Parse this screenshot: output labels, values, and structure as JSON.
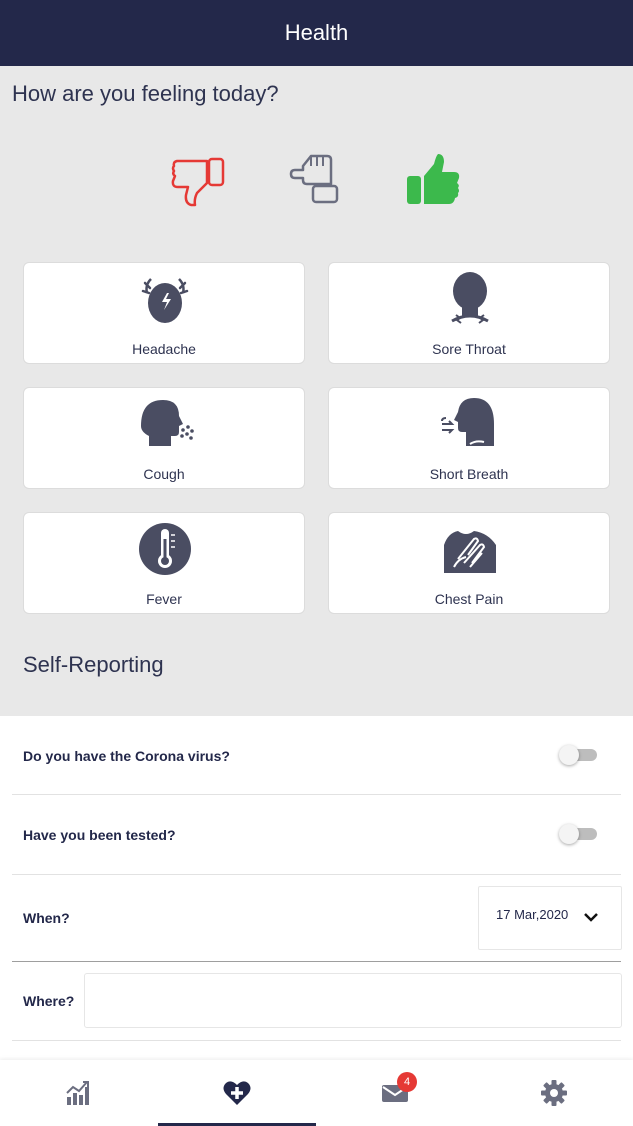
{
  "header": {
    "title": "Health"
  },
  "feeling": {
    "question": "How are you feeling today?",
    "options": [
      {
        "icon": "thumbs-down-icon",
        "color": "#e53935"
      },
      {
        "icon": "thumbs-sideways-icon",
        "color": "#6b6e80"
      },
      {
        "icon": "thumbs-up-icon",
        "color": "#3cb94c"
      }
    ]
  },
  "symptoms": [
    {
      "label": "Headache",
      "icon": "headache-icon"
    },
    {
      "label": "Sore Throat",
      "icon": "sore-throat-icon"
    },
    {
      "label": "Cough",
      "icon": "cough-icon"
    },
    {
      "label": "Short Breath",
      "icon": "short-breath-icon"
    },
    {
      "label": "Fever",
      "icon": "fever-thermometer-icon"
    },
    {
      "label": "Chest Pain",
      "icon": "chest-pain-icon"
    }
  ],
  "self_reporting": {
    "title": "Self-Reporting",
    "corona_question": "Do you have the Corona virus?",
    "corona_value": false,
    "tested_question": "Have you been tested?",
    "tested_value": false,
    "when_label": "When?",
    "when_value": "17 Mar,2020",
    "where_label": "Where?",
    "where_value": ""
  },
  "tabbar": {
    "tabs": [
      {
        "icon": "stats-chart-icon"
      },
      {
        "icon": "health-heart-plus-icon",
        "active": true
      },
      {
        "icon": "mail-icon",
        "badge": "4"
      },
      {
        "icon": "settings-gear-icon"
      }
    ],
    "colors": {
      "icon": "#6b6e80",
      "active": "#23284a",
      "badge": "#e53935"
    }
  }
}
